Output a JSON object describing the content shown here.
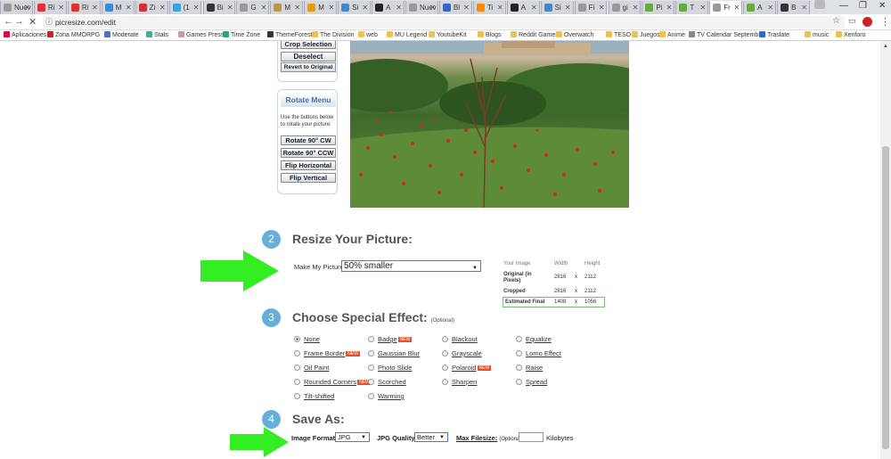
{
  "tabs": [
    {
      "label": "Nuev",
      "color": "#999"
    },
    {
      "label": "Ri",
      "color": "#d33"
    },
    {
      "label": "Ri",
      "color": "#d33"
    },
    {
      "label": "M",
      "color": "#3a8ad8"
    },
    {
      "label": "Zi",
      "color": "#c33"
    },
    {
      "label": "(1",
      "color": "#3aa3e0"
    },
    {
      "label": "Bi",
      "color": "#333"
    },
    {
      "label": "G",
      "color": "#999"
    },
    {
      "label": "M",
      "color": "#b94"
    },
    {
      "label": "M",
      "color": "#e90"
    },
    {
      "label": "Si",
      "color": "#48c"
    },
    {
      "label": "A",
      "color": "#222"
    },
    {
      "label": "Nuev",
      "color": "#999"
    },
    {
      "label": "Bl",
      "color": "#36c"
    },
    {
      "label": "Ti",
      "color": "#f80"
    },
    {
      "label": "A",
      "color": "#222"
    },
    {
      "label": "Si",
      "color": "#48c"
    },
    {
      "label": "Fi",
      "color": "#999"
    },
    {
      "label": "gi",
      "color": "#999"
    },
    {
      "label": "Pi",
      "color": "#6a4"
    },
    {
      "label": "T",
      "color": "#6a4"
    },
    {
      "label": "Fr",
      "color": "#999"
    },
    {
      "label": "A",
      "color": "#6a4"
    },
    {
      "label": "B",
      "color": "#333"
    }
  ],
  "window": {
    "minimize": "—",
    "maximize": "❐",
    "close": "✕"
  },
  "url": "picresize.com/edit",
  "bookmarks": [
    "Aplicaciones",
    "Zona MMORPG",
    "Moderate",
    "Stats",
    "Games Press",
    "Time Zone",
    "ThemeForest",
    "The Division",
    "web",
    "MU Legend",
    "YoutubeKit",
    "Blogs",
    "Reddit Games",
    "Overwatch",
    "TESO",
    "Juegos",
    "Anime",
    "TV Calendar Septemb",
    "Traslate",
    "music",
    "Xenforo"
  ],
  "crop": {
    "btn_crop": "Crop Selection",
    "btn_deselect": "Deselect",
    "btn_revert": "Revert to Original"
  },
  "rotate": {
    "title": "Rotate Menu",
    "desc": "Use the buttons below to rotate your picture:",
    "cw": "Rotate 90° CW",
    "ccw": "Rotate 90° CCW",
    "fh": "Flip Horizontal",
    "fv": "Flip Vertical"
  },
  "resize": {
    "num": "2",
    "title": "Resize Your Picture:",
    "label": "Make My Picture:",
    "value": "50% smaller"
  },
  "dims": {
    "h_image": "Your Image",
    "h_width": "Width",
    "h_height": "Height",
    "orig_label": "Original (in Pixels)",
    "orig_w": "2816",
    "orig_h": "2112",
    "crop_label": "Cropped",
    "crop_w": "2816",
    "crop_h": "2112",
    "est_label": "Estimated Final",
    "est_w": "1408",
    "est_h": "1056",
    "x": "x"
  },
  "effect": {
    "num": "3",
    "title": "Choose Special Effect:",
    "optional": "(Optional)",
    "new": "NEW",
    "options": [
      "None",
      "Badge",
      "Blackout",
      "Equalize",
      "Frame Border",
      "Gaussian Blur",
      "Grayscale",
      "Lomo Effect",
      "Oil Paint",
      "Photo Slide",
      "Polaroid",
      "Raise",
      "Rounded Corners",
      "Scorched",
      "Sharpen",
      "Spread",
      "Tilt-shifted",
      "Warming"
    ]
  },
  "save": {
    "num": "4",
    "title": "Save As:",
    "format_label": "Image Format:",
    "format_value": "JPG",
    "quality_label": "JPG Quality:",
    "quality_value": "Better",
    "filesize_label": "Max Filesize:",
    "filesize_optional": "(Optional)",
    "unit": "Kilobytes"
  },
  "colors": {
    "accent": "#69aed8",
    "arrow": "#33ee22",
    "estimated_border": "#7ac074"
  }
}
